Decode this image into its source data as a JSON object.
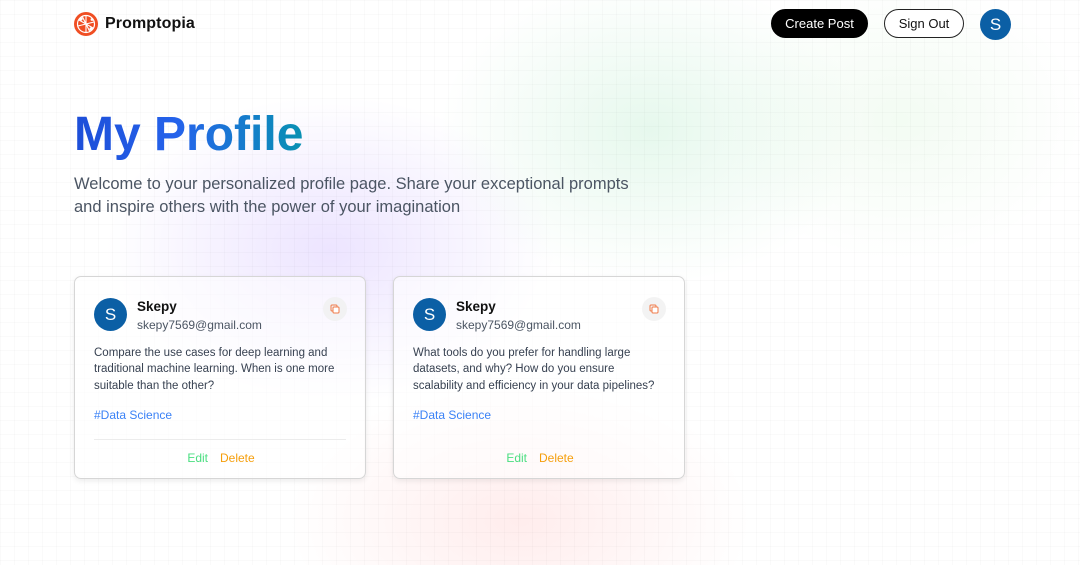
{
  "nav": {
    "brand": "Promptopia",
    "create_post": "Create Post",
    "sign_out": "Sign Out",
    "avatar_initial": "S"
  },
  "hero": {
    "title": "My Profile",
    "description": "Welcome to your personalized profile page. Share your exceptional prompts and inspire others with the power of your imagination"
  },
  "posts": [
    {
      "initial": "S",
      "username": "Skepy",
      "email": "skepy7569@gmail.com",
      "prompt": "Compare the use cases for deep learning and traditional machine learning. When is one more suitable than the other?",
      "tag": "#Data Science",
      "edit": "Edit",
      "delete": "Delete"
    },
    {
      "initial": "S",
      "username": "Skepy",
      "email": "skepy7569@gmail.com",
      "prompt": "What tools do you prefer for handling large datasets, and why? How do you ensure scalability and efficiency in your data pipelines?",
      "tag": "#Data Science",
      "edit": "Edit",
      "delete": "Delete"
    }
  ],
  "colors": {
    "brand_orange": "#f04e23",
    "avatar_blue": "#0b5fa5",
    "tag_blue": "#3b82f6",
    "edit_green": "#4ade80",
    "delete_orange": "#f59e0b"
  },
  "icons": {
    "logo": "promptopia-logo-icon",
    "copy": "copy-icon"
  }
}
